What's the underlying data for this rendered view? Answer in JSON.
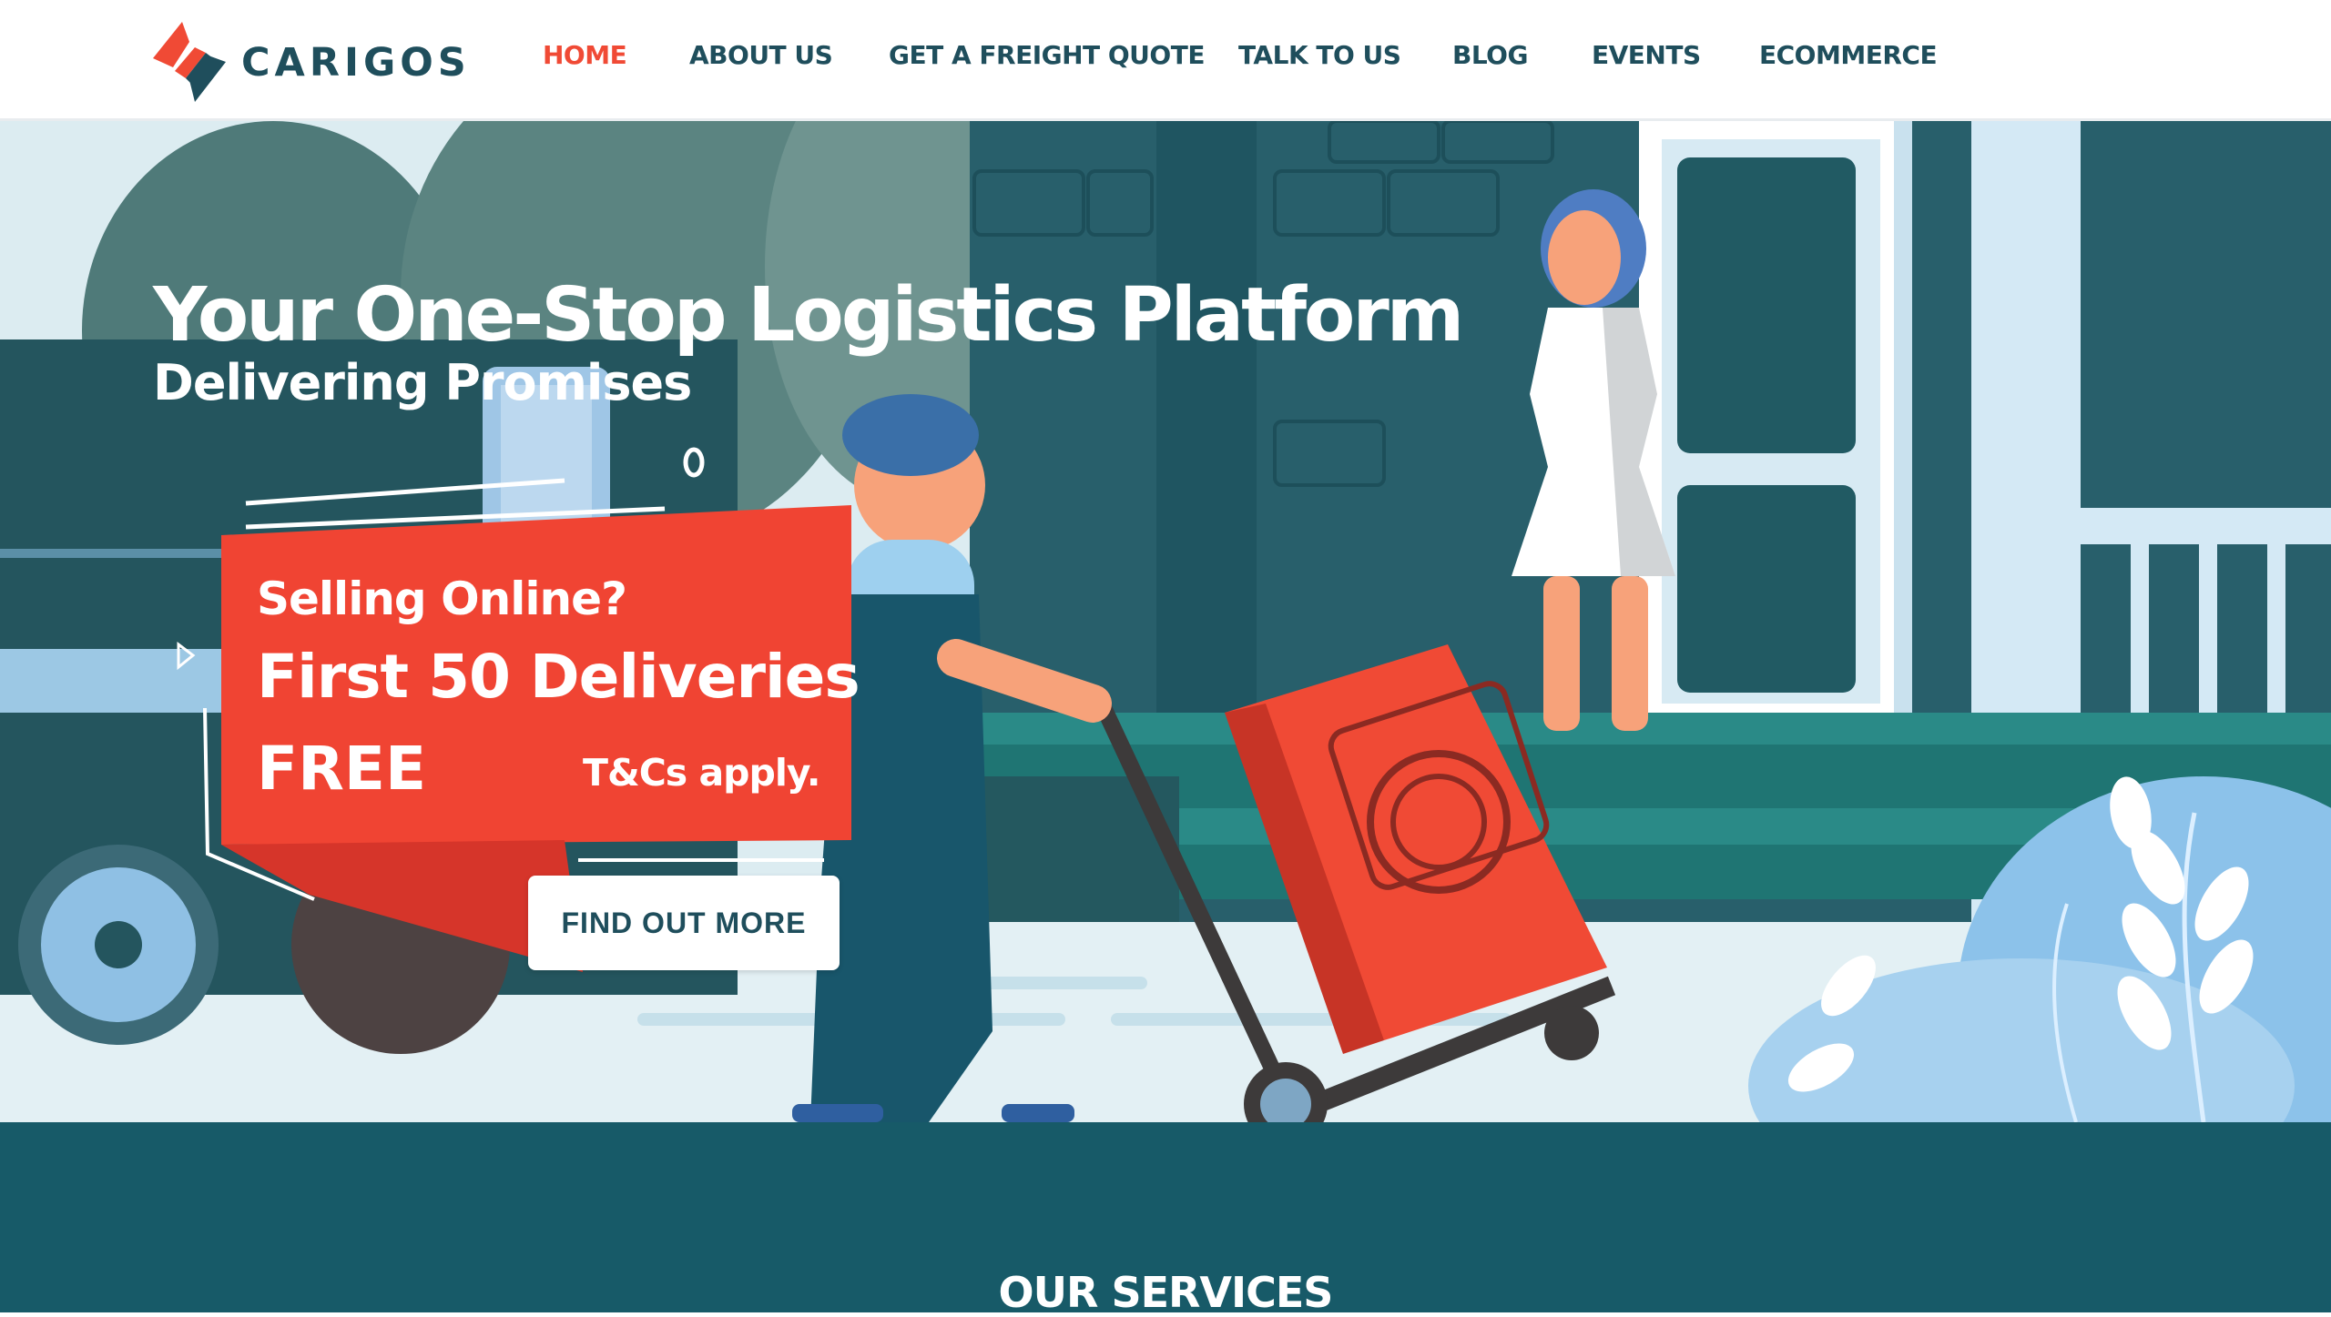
{
  "brand": {
    "name": "CARIGOS",
    "colors": {
      "primary": "#1f4e5c",
      "accent": "#f04a35",
      "band": "#175a68"
    }
  },
  "nav": {
    "items": [
      {
        "label": "HOME",
        "active": true
      },
      {
        "label": "ABOUT US"
      },
      {
        "label": "GET A FREIGHT QUOTE"
      },
      {
        "label": "TALK TO US"
      },
      {
        "label": "BLOG"
      },
      {
        "label": "EVENTS"
      },
      {
        "label": "ECOMMERCE"
      }
    ]
  },
  "hero": {
    "title": "Your One-Stop Logistics Platform",
    "subtitle": "Delivering Promises",
    "promo": {
      "line1": "Selling Online?",
      "line2": "First 50 Deliveries",
      "line3": "FREE",
      "terms": "T&Cs apply."
    },
    "cta_label": "FIND OUT MORE",
    "illustration": "delivery-man-with-hand-truck-and-washing-machine-box"
  },
  "services": {
    "title": "OUR SERVICES"
  }
}
